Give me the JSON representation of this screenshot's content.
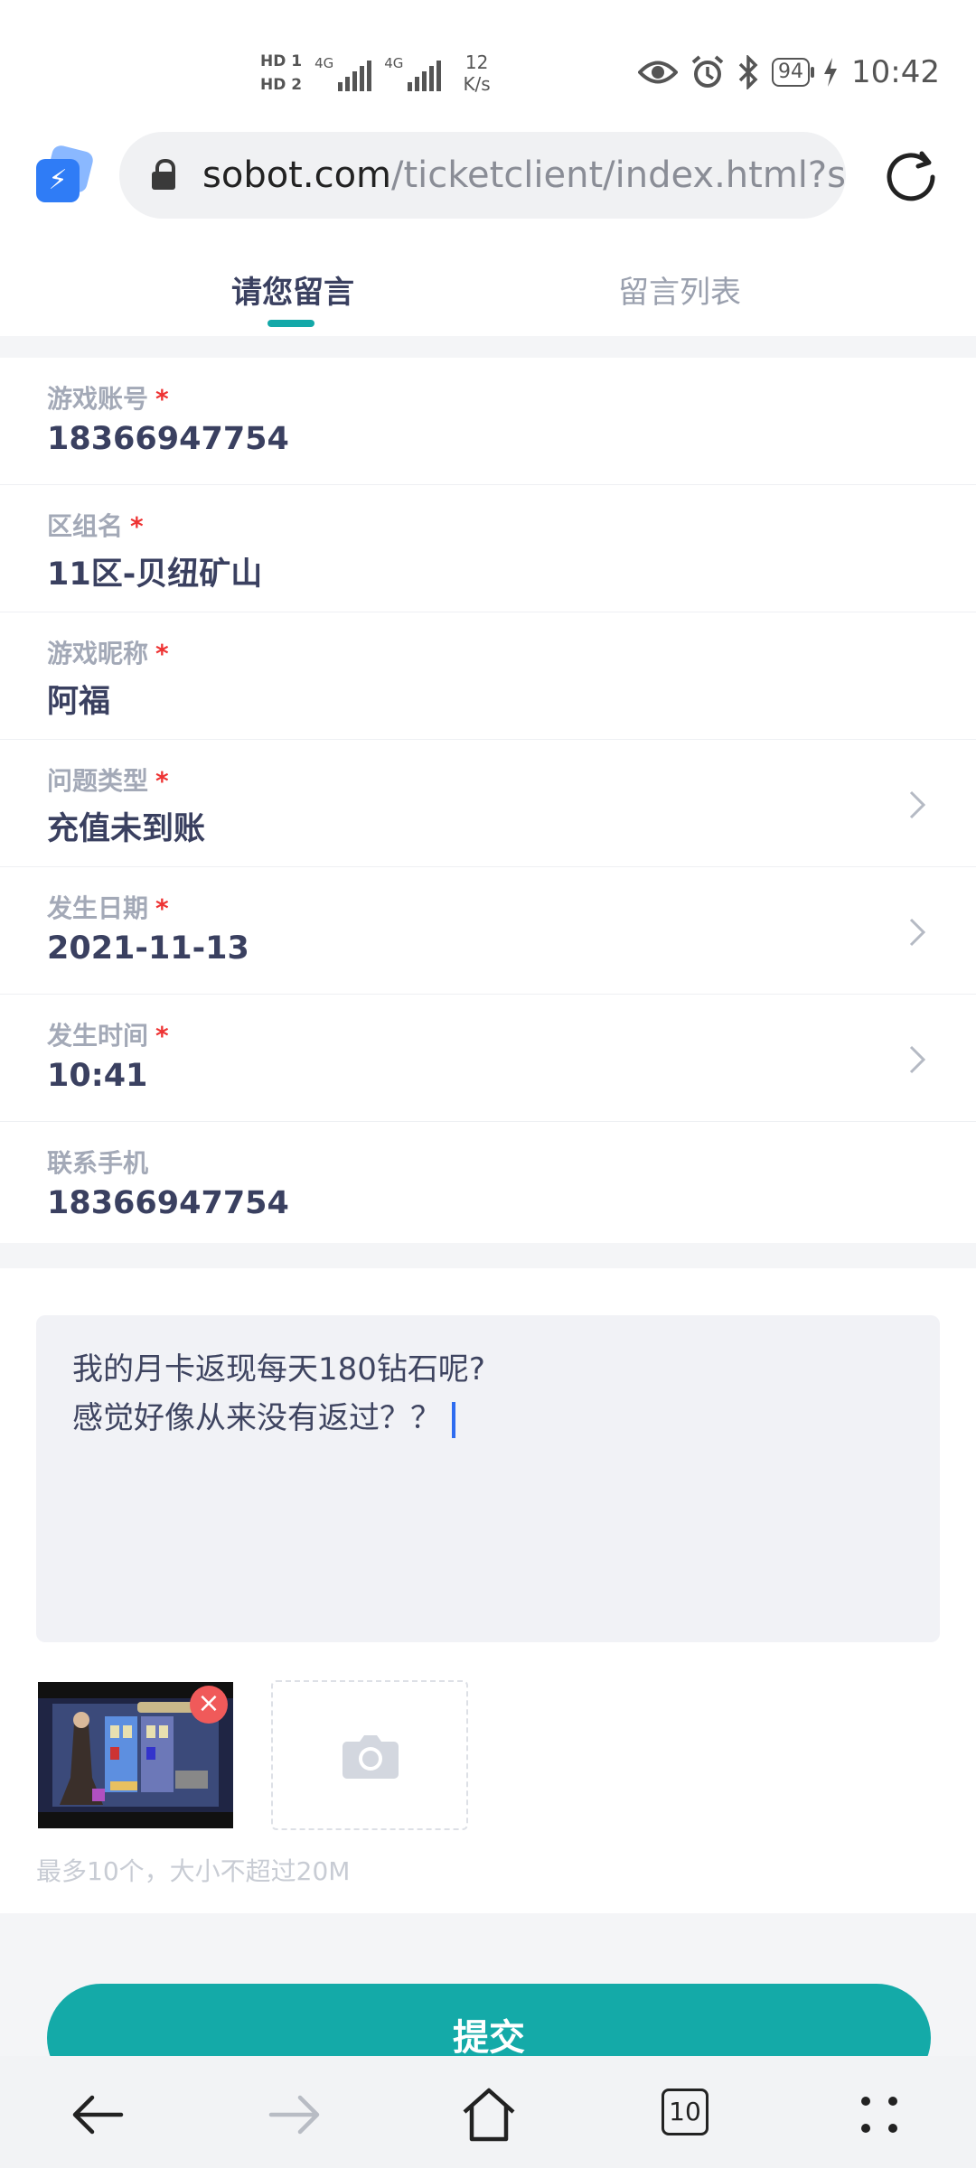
{
  "status_bar": {
    "sim1": "HD 1",
    "sim2": "HD 2",
    "network1": "4G",
    "network2": "4G",
    "speed_value": "12",
    "speed_unit": "K/s",
    "battery": "94",
    "time": "10:42"
  },
  "browser": {
    "url_domain": "sobot.com",
    "url_path": "/ticketclient/index.html?sys"
  },
  "tabs": [
    {
      "label": "请您留言",
      "active": true
    },
    {
      "label": "留言列表",
      "active": false
    }
  ],
  "form": {
    "account": {
      "label": "游戏账号",
      "required": "*",
      "value": "18366947754"
    },
    "server": {
      "label": "区组名",
      "required": "*",
      "value": "11区-贝纽矿山"
    },
    "nickname": {
      "label": "游戏昵称",
      "required": "*",
      "value": "阿福"
    },
    "issue_type": {
      "label": "问题类型",
      "required": "*",
      "value": "充值未到账"
    },
    "date": {
      "label": "发生日期",
      "required": "*",
      "value": "2021-11-13"
    },
    "time": {
      "label": "发生时间",
      "required": "*",
      "value": "10:41"
    },
    "phone": {
      "label": "联系手机",
      "value": "18366947754"
    }
  },
  "description": {
    "line1": "我的月卡返现每天180钻石呢?",
    "line2": "感觉好像从来没有返过？？"
  },
  "upload": {
    "remove_symbol": "×",
    "hint": "最多10个，大小不超过20M"
  },
  "submit_label": "提交",
  "nav": {
    "tab_count": "10"
  },
  "colors": {
    "accent": "#14aaa8",
    "required": "#e33333",
    "remove": "#f05a5a"
  }
}
